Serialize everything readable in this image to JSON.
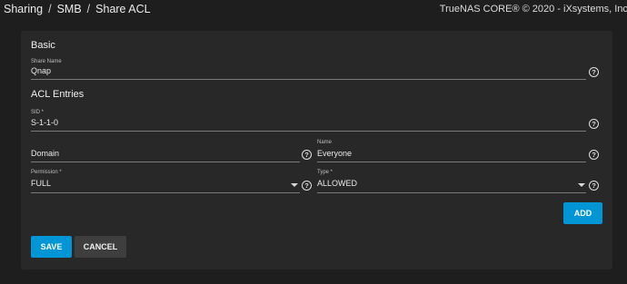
{
  "breadcrumb": [
    "Sharing",
    "SMB",
    "Share ACL"
  ],
  "copyright": "TrueNAS CORE® © 2020 - iXsystems, Inc.",
  "basic": {
    "title": "Basic",
    "share_name": {
      "label": "Share Name",
      "value": "Qnap"
    }
  },
  "acl": {
    "title": "ACL Entries",
    "sid": {
      "label": "SID *",
      "value": "S-1-1-0"
    },
    "domain": {
      "label": "",
      "value": "Domain"
    },
    "name": {
      "label": "Name",
      "value": "Everyone"
    },
    "permission": {
      "label": "Permission *",
      "value": "FULL"
    },
    "type": {
      "label": "Type *",
      "value": "ALLOWED"
    }
  },
  "buttons": {
    "add": "ADD",
    "save": "SAVE",
    "cancel": "CANCEL"
  },
  "colors": {
    "background": "#1e1e1e",
    "card": "#282828",
    "primary": "#0095d5",
    "secondary": "#3e3e3e"
  },
  "icons": {
    "help": "help-circle-icon",
    "dropdown": "caret-down-icon"
  }
}
